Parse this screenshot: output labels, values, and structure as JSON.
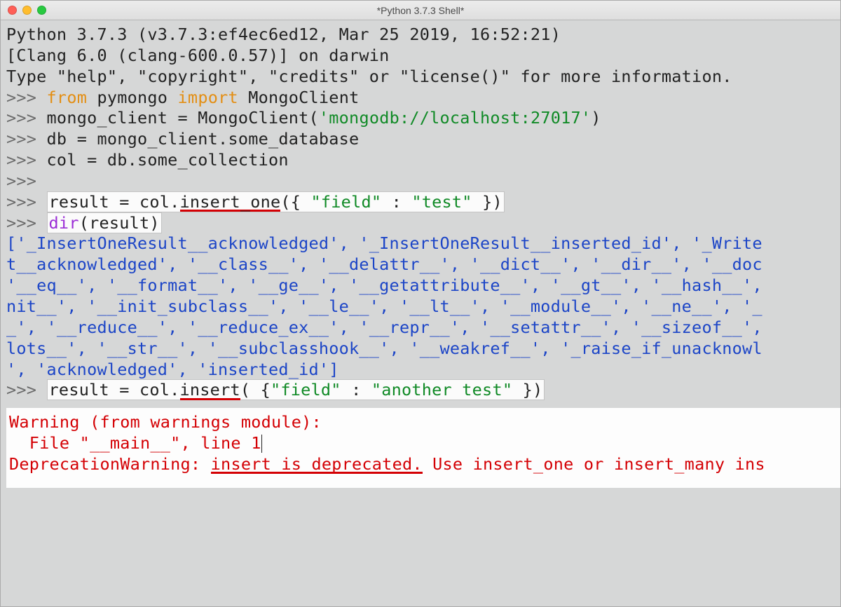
{
  "window": {
    "title": "*Python 3.7.3 Shell*"
  },
  "banner": {
    "line1": "Python 3.7.3 (v3.7.3:ef4ec6ed12, Mar 25 2019, 16:52:21) ",
    "line2": "[Clang 6.0 (clang-600.0.57)] on darwin",
    "line3": "Type \"help\", \"copyright\", \"credits\" or \"license()\" for more information."
  },
  "p": {
    "ps1": ">>> "
  },
  "kw": {
    "from": "from",
    "import": "import"
  },
  "builtin": {
    "dir": "dir"
  },
  "code": {
    "l1_a": " pymongo ",
    "l1_b": " MongoClient",
    "l2_a": "mongo_client = MongoClient(",
    "l2_s": "'mongodb://localhost:27017'",
    "l2_b": ")",
    "l3": "db = mongo_client.some_database",
    "l4": "col = db.some_collection",
    "hl1_a": "result = col.",
    "hl1_u": "insert_one",
    "hl1_b": "({ ",
    "hl1_s1": "\"field\"",
    "hl1_c": " : ",
    "hl1_s2": "\"test\"",
    "hl1_d": " })",
    "hl2_a": "(result)",
    "hl3_a": "result = col.",
    "hl3_u": "insert",
    "hl3_b": "( {",
    "hl3_s1": "\"field\"",
    "hl3_c": " : ",
    "hl3_s2": "\"another test\"",
    "hl3_d": " })"
  },
  "out": {
    "l1": "['_InsertOneResult__acknowledged', '_InsertOneResult__inserted_id', '_Write",
    "l2": "t__acknowledged', '__class__', '__delattr__', '__dict__', '__dir__', '__doc",
    "l3": "'__eq__', '__format__', '__ge__', '__getattribute__', '__gt__', '__hash__',",
    "l4": "nit__', '__init_subclass__', '__le__', '__lt__', '__module__', '__ne__', '_",
    "l5": "_', '__reduce__', '__reduce_ex__', '__repr__', '__setattr__', '__sizeof__',",
    "l6": "lots__', '__str__', '__subclasshook__', '__weakref__', '_raise_if_unacknowl",
    "l7": "', 'acknowledged', 'inserted_id']"
  },
  "err": {
    "l1": "Warning (from warnings module):",
    "l2": "  File \"__main__\", line 1",
    "l3a": "DeprecationWarning: ",
    "l3u": "insert is deprecated.",
    "l3b": " Use insert_one or insert_many ins"
  }
}
